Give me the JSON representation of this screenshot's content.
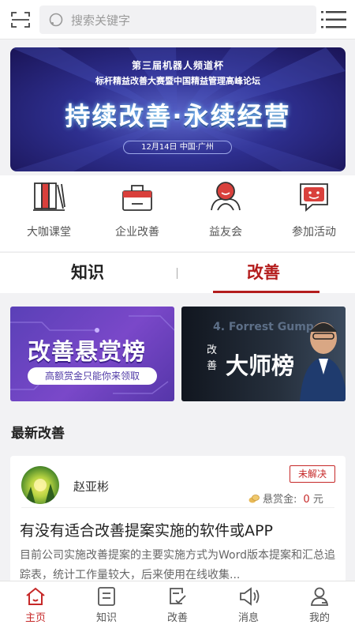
{
  "search": {
    "placeholder": "搜索关键字"
  },
  "banner": {
    "line1": "第三届机器人频道杯",
    "line2": "标杆精益改善大赛暨中国精益管理高峰论坛",
    "headline": "持续改善·永续经营",
    "date_location": "12月14日  中国·广州"
  },
  "quick_nav": [
    {
      "label": "大咖课堂",
      "icon": "books-icon"
    },
    {
      "label": "企业改善",
      "icon": "briefcase-icon"
    },
    {
      "label": "益友会",
      "icon": "friends-icon"
    },
    {
      "label": "参加活动",
      "icon": "chat-smile-icon"
    }
  ],
  "tabs": [
    {
      "label": "知识",
      "active": false
    },
    {
      "label": "改善",
      "active": true
    }
  ],
  "promos": {
    "left": {
      "title": "改善悬赏榜",
      "subtitle": "高额赏金只能你来领取"
    },
    "right": {
      "bg_text": "4. Forrest Gump",
      "small": "改善",
      "title": "大师榜"
    }
  },
  "section_title": "最新改善",
  "post": {
    "username": "赵亚彬",
    "status": "未解决",
    "reward_label": "悬赏金:",
    "reward_amount": "0",
    "reward_unit": "元",
    "title": "有没有适合改善提案实施的软件或APP",
    "excerpt": "目前公司实施改善提案的主要实施方式为Word版本提案和汇总追踪表，统计工作量较大，后来使用在线收集..."
  },
  "bottom_nav": [
    {
      "label": "主页",
      "icon": "home-icon",
      "active": true
    },
    {
      "label": "知识",
      "icon": "book-icon",
      "active": false
    },
    {
      "label": "改善",
      "icon": "edit-icon",
      "active": false
    },
    {
      "label": "消息",
      "icon": "speaker-icon",
      "active": false
    },
    {
      "label": "我的",
      "icon": "user-icon",
      "active": false
    }
  ],
  "colors": {
    "accent": "#c62828",
    "icon_red": "#d9403c"
  }
}
